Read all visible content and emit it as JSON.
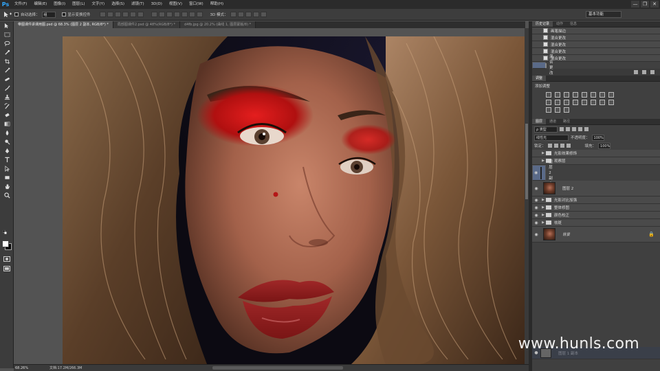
{
  "app": {
    "logo": "Ps"
  },
  "menu": [
    "文件(F)",
    "编辑(E)",
    "图像(I)",
    "图层(L)",
    "文字(Y)",
    "选择(S)",
    "滤镜(T)",
    "3D(D)",
    "视图(V)",
    "窗口(W)",
    "帮助(H)"
  ],
  "window_buttons": [
    "—",
    "❐",
    "✕"
  ],
  "options": {
    "auto_select_label": "自动选择：",
    "auto_select_value": "组",
    "show_transform_label": "显示变换控件",
    "mode_3d_label": "3D 模式：",
    "workspace": "基本功能"
  },
  "doc_tabs": [
    {
      "label": "带图课件讲课用图.psd @ 68.3% (图层 2 副本, RGB/8*) *",
      "active": true
    },
    {
      "label": "局部图课件2.psd @ 48%(RGB/8*) *",
      "active": false
    },
    {
      "label": "d4fb.jpg @ 20.2% (曲线 1, 图层蒙版/8) *",
      "active": false
    }
  ],
  "status": {
    "zoom": "68.26%",
    "doc_size": "文档:17.2M/266.3M"
  },
  "history_panel": {
    "tabs": [
      "历史记录",
      "动作",
      "信息"
    ],
    "rows": [
      "画笔描边",
      "混合更改",
      "混合更改",
      "混合更改",
      "混合更改",
      "混合更改"
    ],
    "selected_index": 5
  },
  "adjustments_panel": {
    "tab": "调整",
    "title": "添加调整",
    "icon_count": 19
  },
  "layers_panel": {
    "tabs": [
      "图层",
      "通道",
      "路径"
    ],
    "filter_label": "ρ 类型",
    "blend_mode": "线性光",
    "opacity_label": "不透明度：",
    "opacity_value": "100%",
    "lock_label": "锁定：",
    "fill_label": "填充：",
    "fill_value": "100%",
    "layers": [
      {
        "name": "光影效果修饰",
        "kind": "folder",
        "visible": false,
        "selected": false
      },
      {
        "name": "观察层",
        "kind": "folder",
        "visible": false,
        "selected": false
      },
      {
        "name": "图层 2 副本",
        "kind": "gray",
        "visible": true,
        "selected": true
      },
      {
        "name": "图层 2",
        "kind": "photo",
        "visible": true,
        "selected": false
      },
      {
        "name": "光影对比加强",
        "kind": "folder",
        "visible": true,
        "selected": false
      },
      {
        "name": "整体修图",
        "kind": "folder",
        "visible": true,
        "selected": false
      },
      {
        "name": "颜色校正",
        "kind": "folder",
        "visible": true,
        "selected": false
      },
      {
        "name": "祛斑",
        "kind": "folder",
        "visible": true,
        "selected": false
      },
      {
        "name": "背景",
        "kind": "photo",
        "visible": true,
        "selected": false,
        "locked": true
      }
    ],
    "drag_ghost": "图层 1 副本"
  },
  "colors": {
    "accent": "#31a8ff",
    "selected_row": "#5a6a88"
  },
  "watermark": "www.hunls.com"
}
